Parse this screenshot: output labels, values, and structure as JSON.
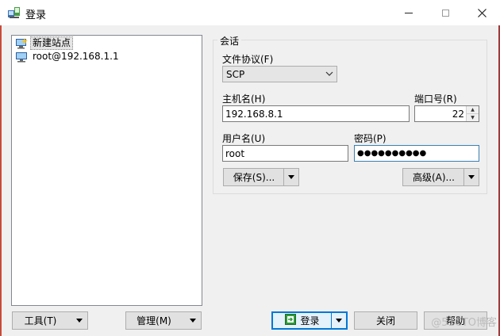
{
  "window": {
    "title": "登录",
    "app_icon": "winscp-icon",
    "minimize_icon": "minimize-icon",
    "maximize_icon": "maximize-icon",
    "close_icon": "close-icon"
  },
  "site_tree": {
    "items": [
      {
        "label": "新建站点",
        "icon": "new-site-icon",
        "selected": true
      },
      {
        "label": "root@192.168.1.1",
        "icon": "computer-icon",
        "selected": false
      }
    ]
  },
  "session": {
    "group_title": "会话",
    "protocol_label": "文件协议(F)",
    "protocol_value": "SCP",
    "host_label": "主机名(H)",
    "host_value": "192.168.8.1",
    "port_label": "端口号(R)",
    "port_value": "22",
    "user_label": "用户名(U)",
    "user_value": "root",
    "password_label": "密码(P)",
    "password_value": "●●●●●●●●●●",
    "save_label": "保存(S)...",
    "advanced_label": "高级(A)..."
  },
  "footer": {
    "tools_label": "工具(T)",
    "manage_label": "管理(M)",
    "login_label": "登录",
    "close_label": "关闭",
    "help_label": "帮助"
  },
  "watermark": "@51CTO博客",
  "colors": {
    "accent": "#0078d7",
    "focus_border": "#3c7fb1",
    "login_icon": "#2e9c3a"
  }
}
